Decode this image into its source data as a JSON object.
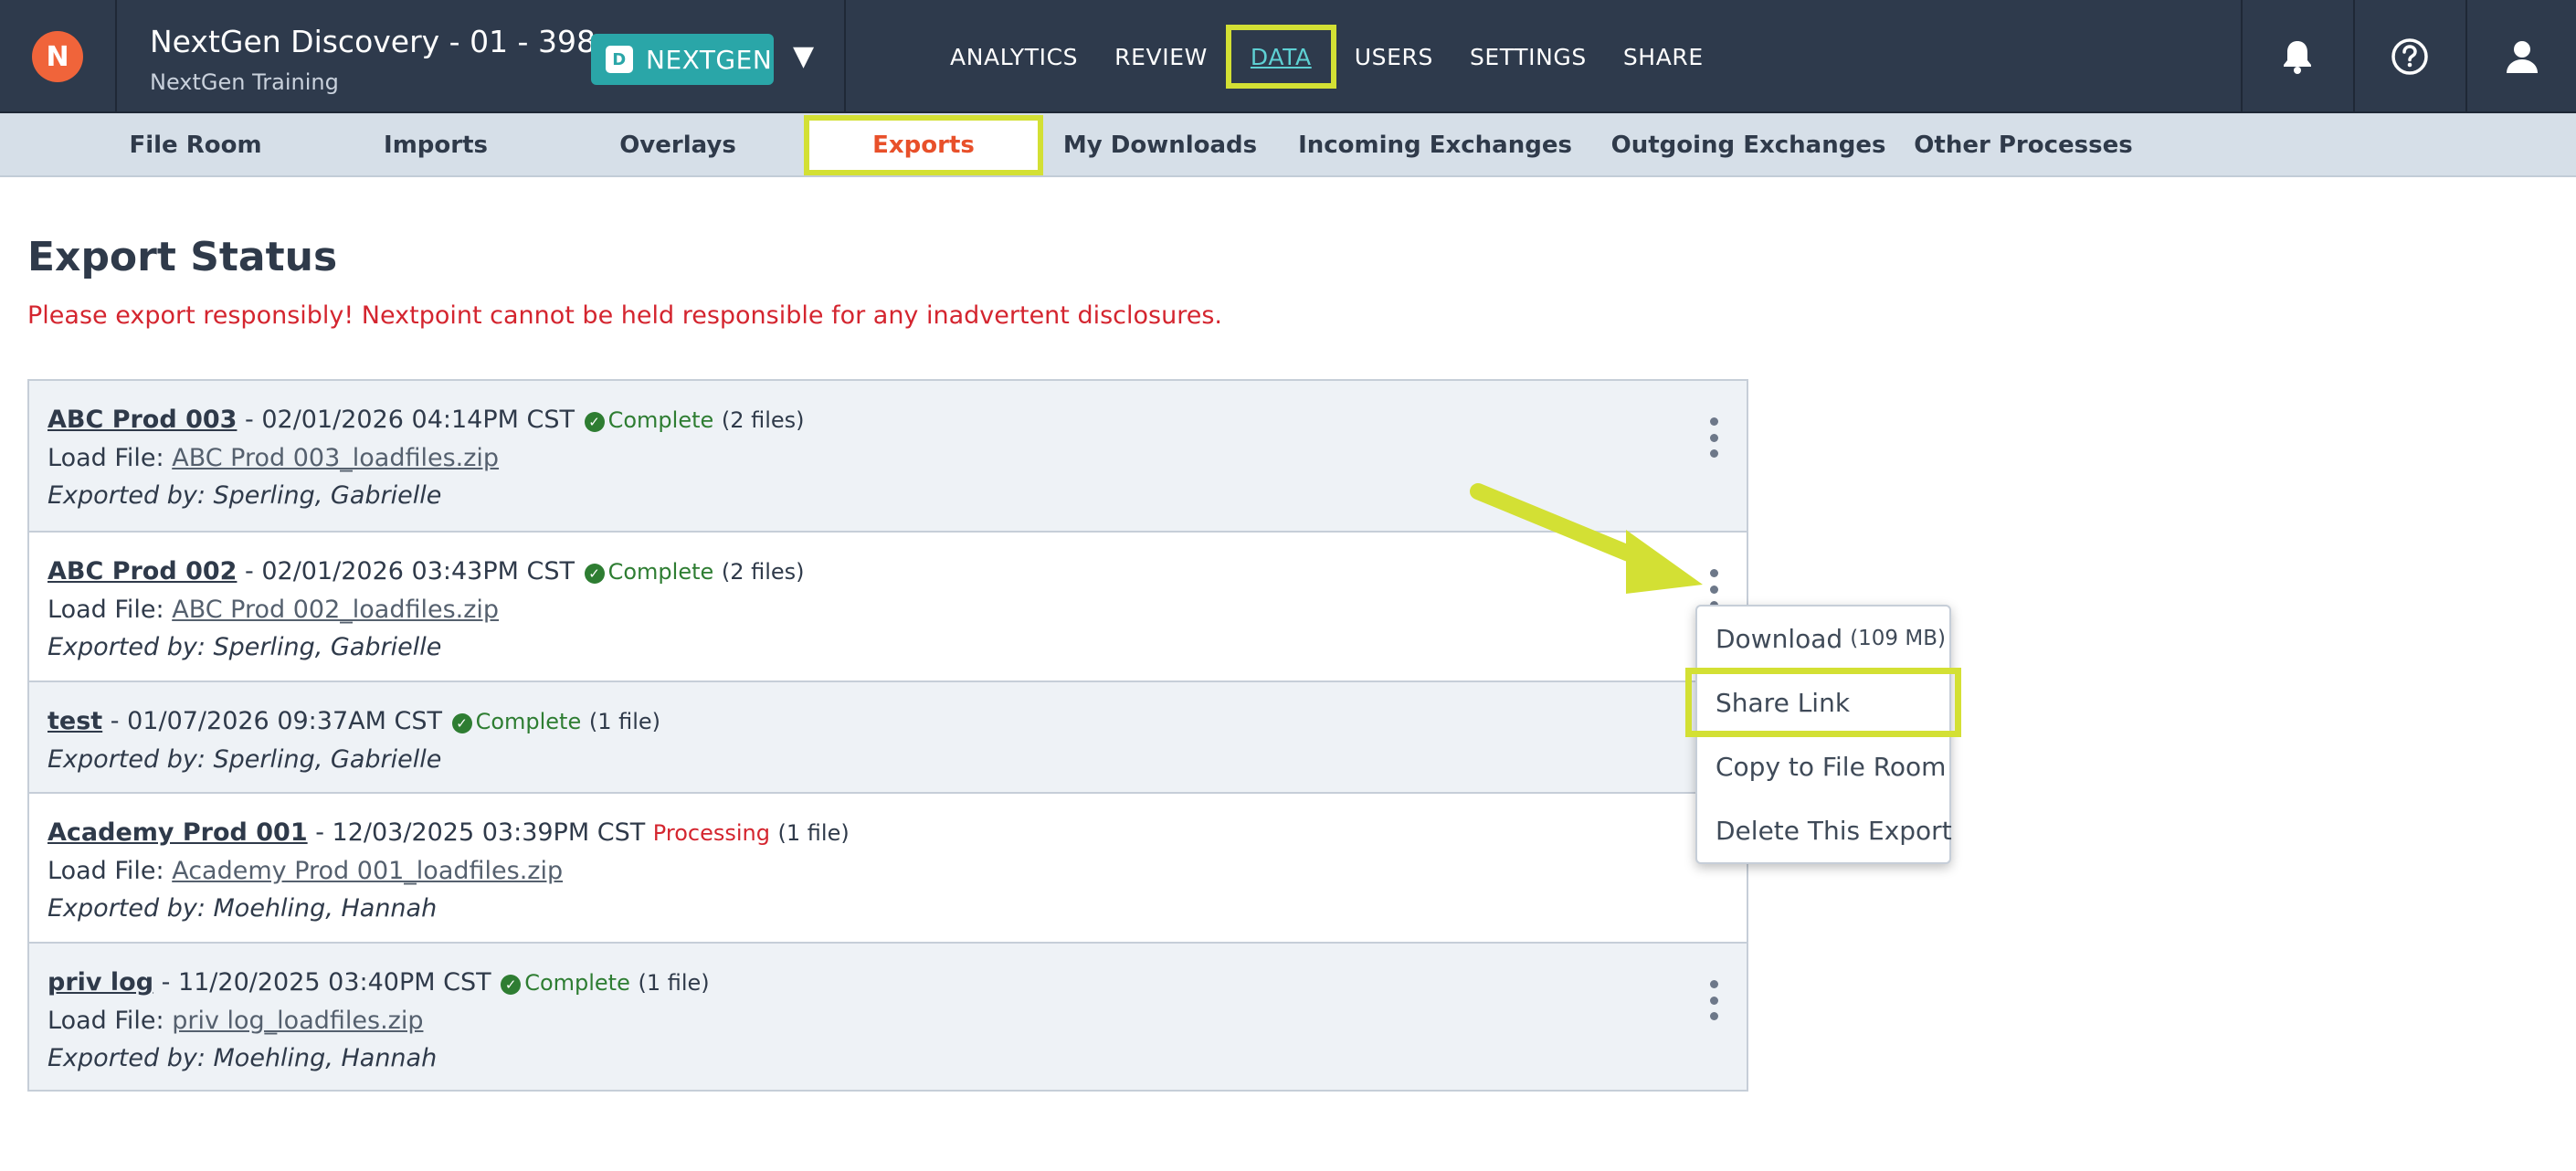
{
  "header": {
    "logo_text": "N",
    "case_title": "NextGen Discovery - 01 - 398...",
    "case_subtitle": "NextGen Training",
    "workspace_letter": "D",
    "workspace_label": "NEXTGEN",
    "workspace_caret": "▼",
    "nav": [
      "ANALYTICS",
      "REVIEW",
      "DATA",
      "USERS",
      "SETTINGS",
      "SHARE"
    ],
    "active_nav": "DATA",
    "icons": [
      "bell-icon",
      "help-icon",
      "user-icon"
    ]
  },
  "subnav": {
    "items": [
      "File Room",
      "Imports",
      "Overlays",
      "Exports",
      "My Downloads",
      "Incoming Exchanges",
      "Outgoing Exchanges",
      "Other Processes"
    ],
    "active": "Exports"
  },
  "page": {
    "title": "Export Status",
    "warning": "Please export responsibly! Nextpoint cannot be held responsible for any inadvertent disclosures."
  },
  "labels": {
    "load_file": "Load File: ",
    "exported_by": "Exported by: "
  },
  "exports": [
    {
      "name": "ABC Prod 003",
      "datetime": " - 02/01/2026 04:14PM CST",
      "status": "Complete",
      "count": "(2 files)",
      "load_file": "ABC Prod 003_loadfiles.zip",
      "exported_by": "Sperling, Gabrielle"
    },
    {
      "name": "ABC Prod 002",
      "datetime": " - 02/01/2026 03:43PM CST",
      "status": "Complete",
      "count": "(2 files)",
      "load_file": "ABC Prod 002_loadfiles.zip",
      "exported_by": "Sperling, Gabrielle"
    },
    {
      "name": "test",
      "datetime": " - 01/07/2026 09:37AM CST",
      "status": "Complete",
      "count": "(1 file)",
      "load_file": "",
      "exported_by": "Sperling, Gabrielle"
    },
    {
      "name": "Academy Prod 001",
      "datetime": " - 12/03/2025 03:39PM CST",
      "status": "Processing",
      "count": "(1 file)",
      "load_file": "Academy Prod 001_loadfiles.zip",
      "exported_by": "Moehling, Hannah"
    },
    {
      "name": "priv log",
      "datetime": " - 11/20/2025 03:40PM CST",
      "status": "Complete",
      "count": "(1 file)",
      "load_file": "priv log_loadfiles.zip",
      "exported_by": "Moehling, Hannah"
    }
  ],
  "menu": {
    "download_label": "Download",
    "download_size": "(109 MB)",
    "share_link": "Share Link",
    "copy_to_file_room": "Copy to File Room",
    "delete_export": "Delete This Export"
  },
  "colors": {
    "topbar": "#2e3a4c",
    "highlight": "#d3e034",
    "accent_orange": "#e8502a",
    "complete_green": "#2e7d32",
    "processing_red": "#d4252f"
  }
}
